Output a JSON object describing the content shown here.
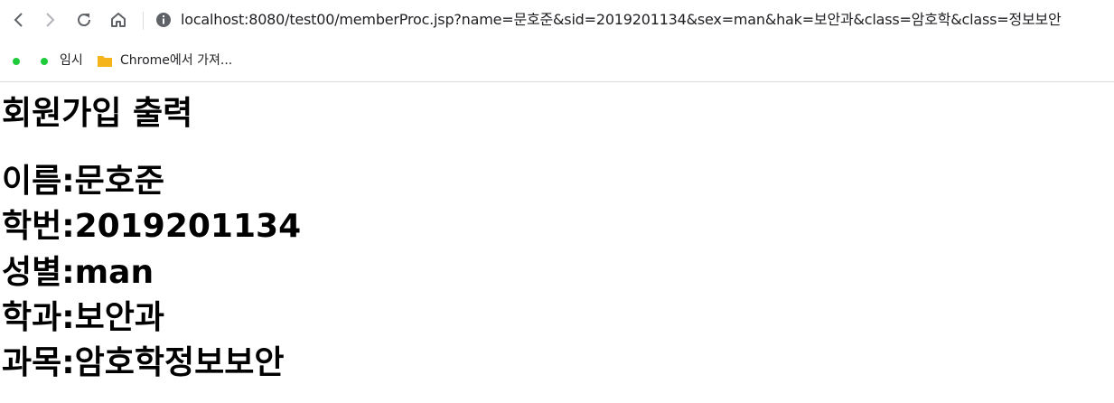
{
  "browser": {
    "url": "localhost:8080/test00/memberProc.jsp?name=문호준&sid=2019201134&sex=man&hak=보안과&class=암호학&class=정보보안",
    "bookmarks": [
      {
        "label": "",
        "color": "#1fca3b"
      },
      {
        "label": "임시",
        "color": "#1fca3b"
      },
      {
        "label": "Chrome에서 가져...",
        "icon": "folder-icon",
        "color": "#f6b41c"
      }
    ]
  },
  "page": {
    "title": "회원가입 출력",
    "rows": [
      {
        "text": "이름:문호준"
      },
      {
        "text": "학번:2019201134"
      },
      {
        "text": "성별:man"
      },
      {
        "text": "학과:보안과"
      },
      {
        "text": "과목:암호학정보보안"
      }
    ]
  }
}
